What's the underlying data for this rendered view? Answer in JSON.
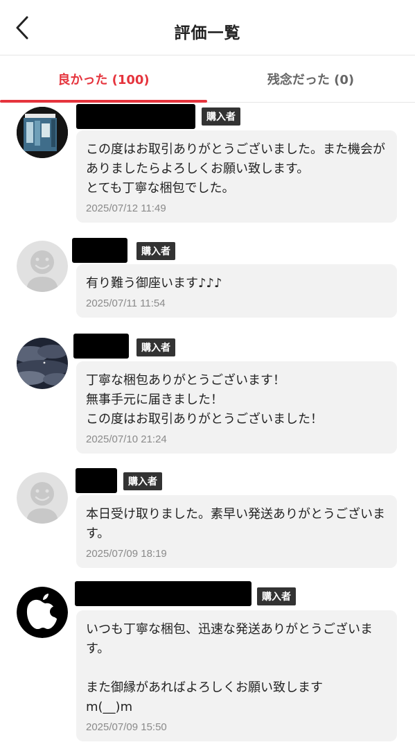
{
  "header": {
    "title": "評価一覧",
    "back_icon": "chevron-left-icon"
  },
  "tabs": [
    {
      "label": "良かった (100)",
      "active": true
    },
    {
      "label": "残念だった (0)",
      "active": false
    }
  ],
  "colors": {
    "accent": "#e5343d",
    "badge_bg": "#333333",
    "bubble_bg": "#f2f2f2"
  },
  "reviews": [
    {
      "avatar": "book-cover-avatar",
      "badge": "購入者",
      "comment": "この度はお取引ありがとうございました。また機会がありましたらよろしくお願い致します。\nとても丁寧な梱包でした。",
      "date": "2025/07/12 11:49"
    },
    {
      "avatar": "default-face-avatar",
      "badge": "購入者",
      "comment": "有り難う御座います♪♪♪",
      "date": "2025/07/11 11:54"
    },
    {
      "avatar": "night-sky-avatar",
      "badge": "購入者",
      "comment": "丁寧な梱包ありがとうございます！\n無事手元に届きました！\nこの度はお取引ありがとうございました！",
      "date": "2025/07/10 21:24"
    },
    {
      "avatar": "default-face-avatar",
      "badge": "購入者",
      "comment": "本日受け取りました。素早い発送ありがとうございます。",
      "date": "2025/07/09 18:19"
    },
    {
      "avatar": "apple-logo-avatar",
      "badge": "購入者",
      "comment": "いつも丁寧な梱包、迅速な発送ありがとうございます。\n\nまた御縁があればよろしくお願い致します\nm(__)m",
      "date": "2025/07/09 15:50"
    }
  ]
}
